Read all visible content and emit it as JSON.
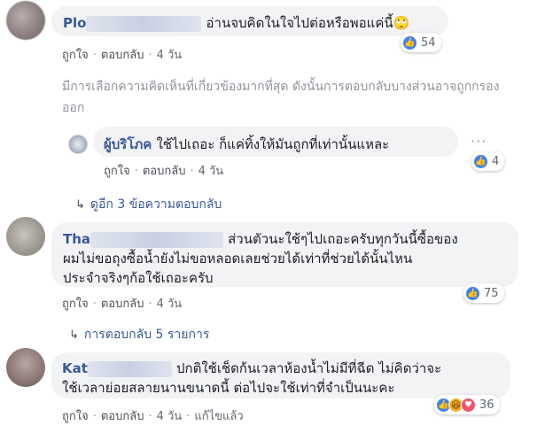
{
  "comments": [
    {
      "name": "Plo",
      "text": "อ่านจบคิดในใจไปต่อหรือพอแค่นี้🙄",
      "actions": {
        "like": "ถูกใจ",
        "reply": "ตอบกลับ",
        "time": "4 วัน"
      },
      "reactions": {
        "count": "54"
      }
    },
    {
      "name": "Tha",
      "text_lines": [
        "ส่วนตัวนะใช้ๆไปเถอะครับทุกวันนี้ซื้อของ",
        "ผมไม่ขอถุงซื้อน้ำยังไม่ขอหลอดเลยช่วยได้เท่าที่ช่วยได้นั้นไหน",
        "ประจำจริงๆก้อใช้เถอะครับ"
      ],
      "actions": {
        "like": "ถูกใจ",
        "reply": "ตอบกลับ",
        "time": "4 วัน"
      },
      "reactions": {
        "count": "75"
      }
    },
    {
      "name": "Kat",
      "text_lines": [
        "ปกติใช้เช็ดก้นเวลาห้องน้ำไม่มีที่ฉีด ไม่คิดว่าจะ",
        "ใช้เวลาย่อยสลายนานขนาดนี้ ต่อไปจะใช้เท่าที่จำเป็นนะคะ"
      ],
      "actions": {
        "like": "ถูกใจ",
        "reply": "ตอบกลับ",
        "time": "4 วัน",
        "edited": "แก้ไขแล้ว"
      },
      "reactions": {
        "count": "36"
      }
    }
  ],
  "relevance_note": "มีการเลือกความคิดเห็นที่เกี่ยวข้องมากที่สุด ดังนั้นการตอบกลับบางส่วนอาจถูกกรองออก",
  "reply": {
    "name": "ผู้บริโภค",
    "text": "ใช้ไปเถอะ ก็แค่ทิ้งให้มันถูกที่เท่านั้นแหละ",
    "actions": {
      "like": "ถูกใจ",
      "reply": "ตอบกลับ",
      "time": "4 วัน"
    },
    "reactions": {
      "count": "4"
    },
    "more_button": "···"
  },
  "view_more_replies": "ดูอีก 3 ข้อความตอบกลับ",
  "replies_link": "การตอบกลับ 5 รายการ",
  "colors": {
    "link": "#385898",
    "bubble": "#f2f3f5",
    "like_blue": "#3b82f6"
  }
}
